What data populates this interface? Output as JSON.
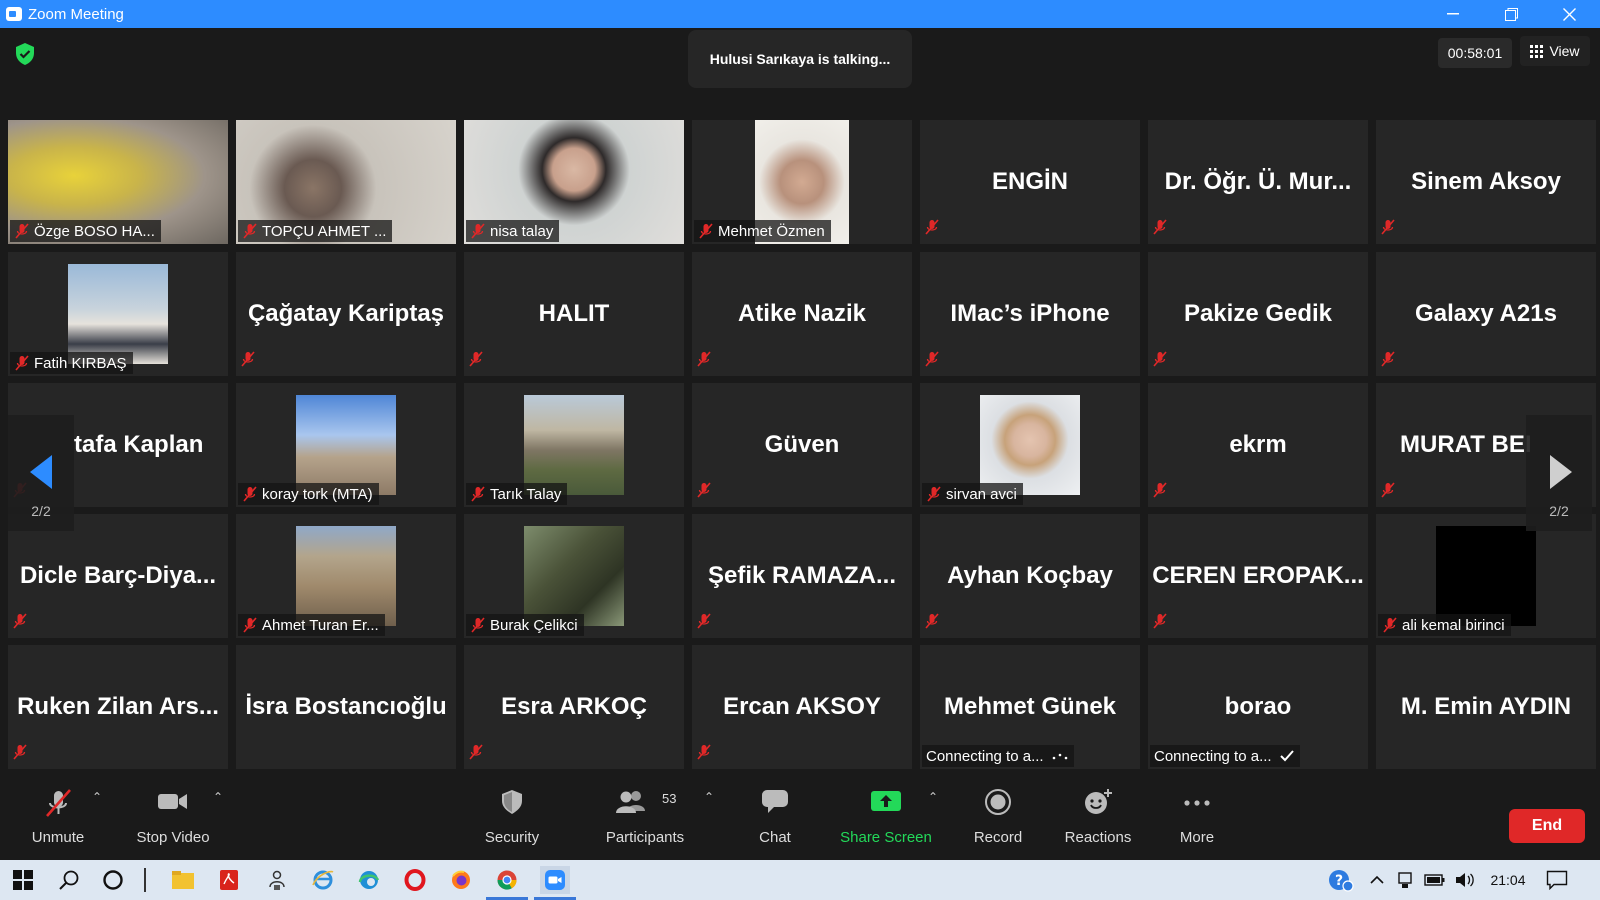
{
  "window": {
    "title": "Zoom Meeting"
  },
  "header": {
    "talking": "Hulusi Sarıkaya is talking...",
    "timer": "00:58:01",
    "view_label": "View"
  },
  "nav": {
    "left_page": "2/2",
    "right_page": "2/2"
  },
  "tiles": [
    {
      "name": "Özge BOSO HA...",
      "type": "video",
      "photo": "yellow-blur"
    },
    {
      "name": "TOPÇU AHMET ...",
      "type": "video",
      "photo": "man-office"
    },
    {
      "name": "nisa talay",
      "type": "video",
      "photo": "woman-room"
    },
    {
      "name": "Mehmet Özmen",
      "type": "video-small",
      "photo": "older-man"
    },
    {
      "name": "ENGİN",
      "type": "name"
    },
    {
      "name": "Dr. Öğr. Ü. Mur...",
      "type": "name"
    },
    {
      "name": "Sinem Aksoy",
      "type": "name"
    },
    {
      "name": "Fatih KIRBAŞ",
      "type": "photo",
      "photo": "man-suit"
    },
    {
      "name": "Çağatay Kariptaş",
      "type": "name"
    },
    {
      "name": "HALIT",
      "type": "name"
    },
    {
      "name": "Atike Nazik",
      "type": "name"
    },
    {
      "name": "IMac’s iPhone",
      "type": "name"
    },
    {
      "name": "Pakize Gedik",
      "type": "name"
    },
    {
      "name": "Galaxy A21s",
      "type": "name"
    },
    {
      "name": "tafa Kaplan",
      "type": "name"
    },
    {
      "name": "koray tork (MTA)",
      "type": "photo",
      "photo": "mountain"
    },
    {
      "name": "Tarık Talay",
      "type": "photo",
      "photo": "building"
    },
    {
      "name": "Güven",
      "type": "name"
    },
    {
      "name": "sirvan avci",
      "type": "photo",
      "photo": "woman-portrait"
    },
    {
      "name": "ekrm",
      "type": "name"
    },
    {
      "name": "MURAT BEI",
      "type": "name"
    },
    {
      "name": "Dicle  Barç-Diya...",
      "type": "name"
    },
    {
      "name": "Ahmet Turan Er...",
      "type": "photo",
      "photo": "rocks"
    },
    {
      "name": "Burak Çelikci",
      "type": "photo",
      "photo": "telescope"
    },
    {
      "name": "Şefik  RAMAZA...",
      "type": "name"
    },
    {
      "name": "Ayhan Koçbay",
      "type": "name"
    },
    {
      "name": "CEREN  EROPAK...",
      "type": "name"
    },
    {
      "name": "ali kemal birinci",
      "type": "photo",
      "photo": "black"
    },
    {
      "name": "Ruken  Zilan  Ars...",
      "type": "name"
    },
    {
      "name": "İsra Bostancıoğlu",
      "type": "name",
      "nomute": true
    },
    {
      "name": "Esra  ARKOÇ",
      "type": "name"
    },
    {
      "name": "Ercan AKSOY",
      "type": "name"
    },
    {
      "name": "Mehmet Günek",
      "type": "name",
      "status": "Connecting to a...",
      "status_icon": "dots"
    },
    {
      "name": "borao",
      "type": "name",
      "status": "Connecting to a...",
      "status_icon": "check"
    },
    {
      "name": "M. Emin AYDIN",
      "type": "name",
      "nomute": true
    }
  ],
  "toolbar": {
    "unmute": "Unmute",
    "stop_video": "Stop Video",
    "security": "Security",
    "participants": "Participants",
    "participants_count": "53",
    "chat": "Chat",
    "share_screen": "Share Screen",
    "record": "Record",
    "reactions": "Reactions",
    "more": "More",
    "end": "End"
  },
  "taskbar": {
    "time": "21:04"
  },
  "colors": {
    "zoom_blue": "#2d8cff",
    "share_green": "#23d959",
    "end_red": "#e02828",
    "mute_red": "#e02828"
  }
}
